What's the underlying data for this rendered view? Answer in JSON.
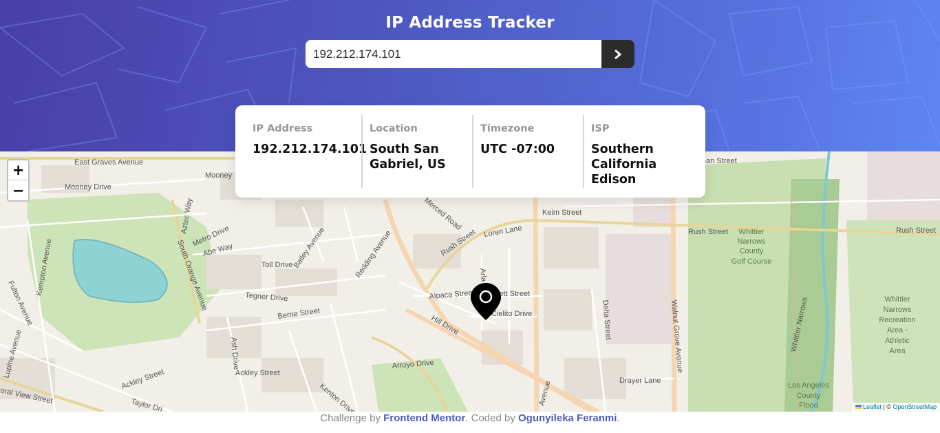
{
  "header": {
    "title": "IP Address Tracker",
    "background_gradient": [
      "#4a3fa6",
      "#5e86f0"
    ]
  },
  "search": {
    "value": "192.212.174.101",
    "submit_icon": "chevron-right-icon",
    "button_color": "#2b2b2b"
  },
  "info": {
    "ip": {
      "label": "IP Address",
      "value": "192.212.174.101"
    },
    "location": {
      "label": "Location",
      "value": "South San Gabriel, US"
    },
    "timezone": {
      "label": "Timezone",
      "value": "UTC -07:00"
    },
    "isp": {
      "label": "ISP",
      "value": "Southern California Edison"
    }
  },
  "map": {
    "zoom_in": "+",
    "zoom_out": "−",
    "marker_icon": "location-pin-icon",
    "attribution": {
      "leaflet": "Leaflet",
      "separator": " | © ",
      "osm": "OpenStreetMap"
    },
    "labels": {
      "east_graves": "East Graves Avenue",
      "mooney_drive": "Mooney Drive",
      "mooney": "Mooney",
      "aztec_way": "Aztec Way",
      "metro_drive": "Metro Drive",
      "abe_way": "Abe Way",
      "south_orange": "South Orange Avenue",
      "kempton": "Kempton Avenue",
      "fulton": "Fulton Avenue",
      "toll_drive": "Toll Drive",
      "bailey": "Bailey Avenue",
      "redding": "Redding Avenue",
      "tegner": "Tegner Drive",
      "berne": "Berne Street",
      "ash_drive": "Ash Drive",
      "ackley_street": "Ackley Street",
      "ackley_street2": "Ackley Street",
      "taylor": "Taylor Dri",
      "lupine": "Lupine Avenue",
      "oral_view": "oral View Street",
      "kenton": "Kenton Drive",
      "arroyo": "Arroyo Drive",
      "hill_drive": "Hill Drive",
      "alpaca": "Alpaca Street",
      "ellet": "vett Street",
      "cielito": "Cielito Drive",
      "rush_street_diag": "Rush Street",
      "loren": "Loren Lane",
      "verced": "Merced Road",
      "keim": "Keim Street",
      "rush_street": "Rush Street",
      "rush_street_right": "Rush Street",
      "whittier_golf": [
        "Whittier",
        "Narrows",
        "County",
        "Golf Course"
      ],
      "delta": "Delta Street",
      "walnut_grove": "Walnut Grove Avenue",
      "drayer": "Drayer Lane",
      "whittier_narrows": "Whittier Narrows",
      "recreation": [
        "Whittier",
        "Narrows",
        "Recreation",
        "Area -",
        "Athletic",
        "Area"
      ],
      "la_flood": [
        "Los Angeles",
        "County",
        "Flood"
      ],
      "inan_street": "nan Street",
      "arla": "Arla",
      "avenue_bottom": "Avenue"
    }
  },
  "footer": {
    "prefix": "Challenge by ",
    "challenge_link": "Frontend Mentor",
    "middle": ". Coded by ",
    "author_link": "Ogunyileka Feranmi",
    "suffix": "."
  }
}
